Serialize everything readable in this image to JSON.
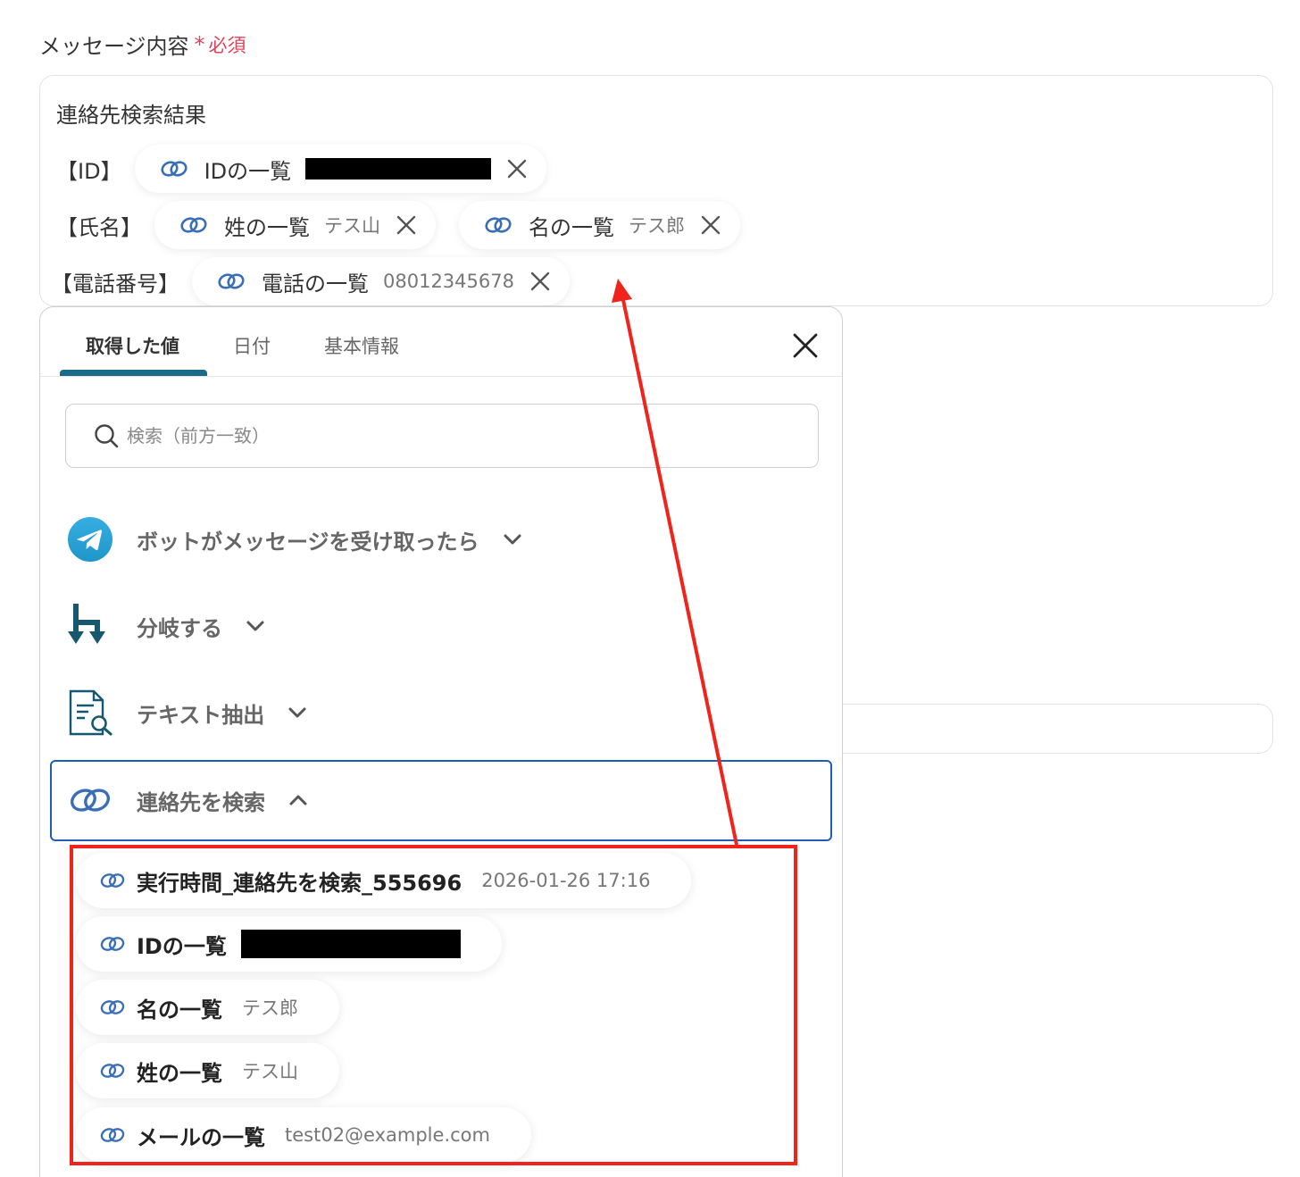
{
  "field": {
    "label": "メッセージ内容",
    "required_star": "*",
    "required_text": "必須"
  },
  "editor": {
    "line1": "連絡先検索結果",
    "id_label": "【ID】",
    "name_label": "【氏名】",
    "phone_label": "【電話番号】",
    "chips": {
      "id": {
        "name": "IDの一覧"
      },
      "last_name": {
        "name": "姓の一覧",
        "value": "テス山"
      },
      "first_name": {
        "name": "名の一覧",
        "value": "テス郎"
      },
      "phone": {
        "name": "電話の一覧",
        "value": "08012345678"
      }
    }
  },
  "panel": {
    "tabs": [
      "取得した値",
      "日付",
      "基本情報"
    ],
    "search_placeholder": "検索（前方一致）",
    "groups": [
      {
        "label": "ボットがメッセージを受け取ったら",
        "icon": "telegram-icon"
      },
      {
        "label": "分岐する",
        "icon": "branch-icon"
      },
      {
        "label": "テキスト抽出",
        "icon": "document-search-icon"
      },
      {
        "label": "連絡先を検索",
        "icon": "link-icon"
      }
    ],
    "items": [
      {
        "name": "実行時間_連絡先を検索_555696",
        "value": "2026-01-26 17:16"
      },
      {
        "name": "IDの一覧"
      },
      {
        "name": "名の一覧",
        "value": "テス郎"
      },
      {
        "name": "姓の一覧",
        "value": "テス山"
      },
      {
        "name": "メールの一覧",
        "value": "test02@example.com"
      }
    ]
  },
  "colors": {
    "accent": "#1a6b8a",
    "link_icon": "#3a6fb8",
    "required": "#e0435a",
    "highlight": "#f0241b",
    "selected_border": "#1e5fb4"
  }
}
